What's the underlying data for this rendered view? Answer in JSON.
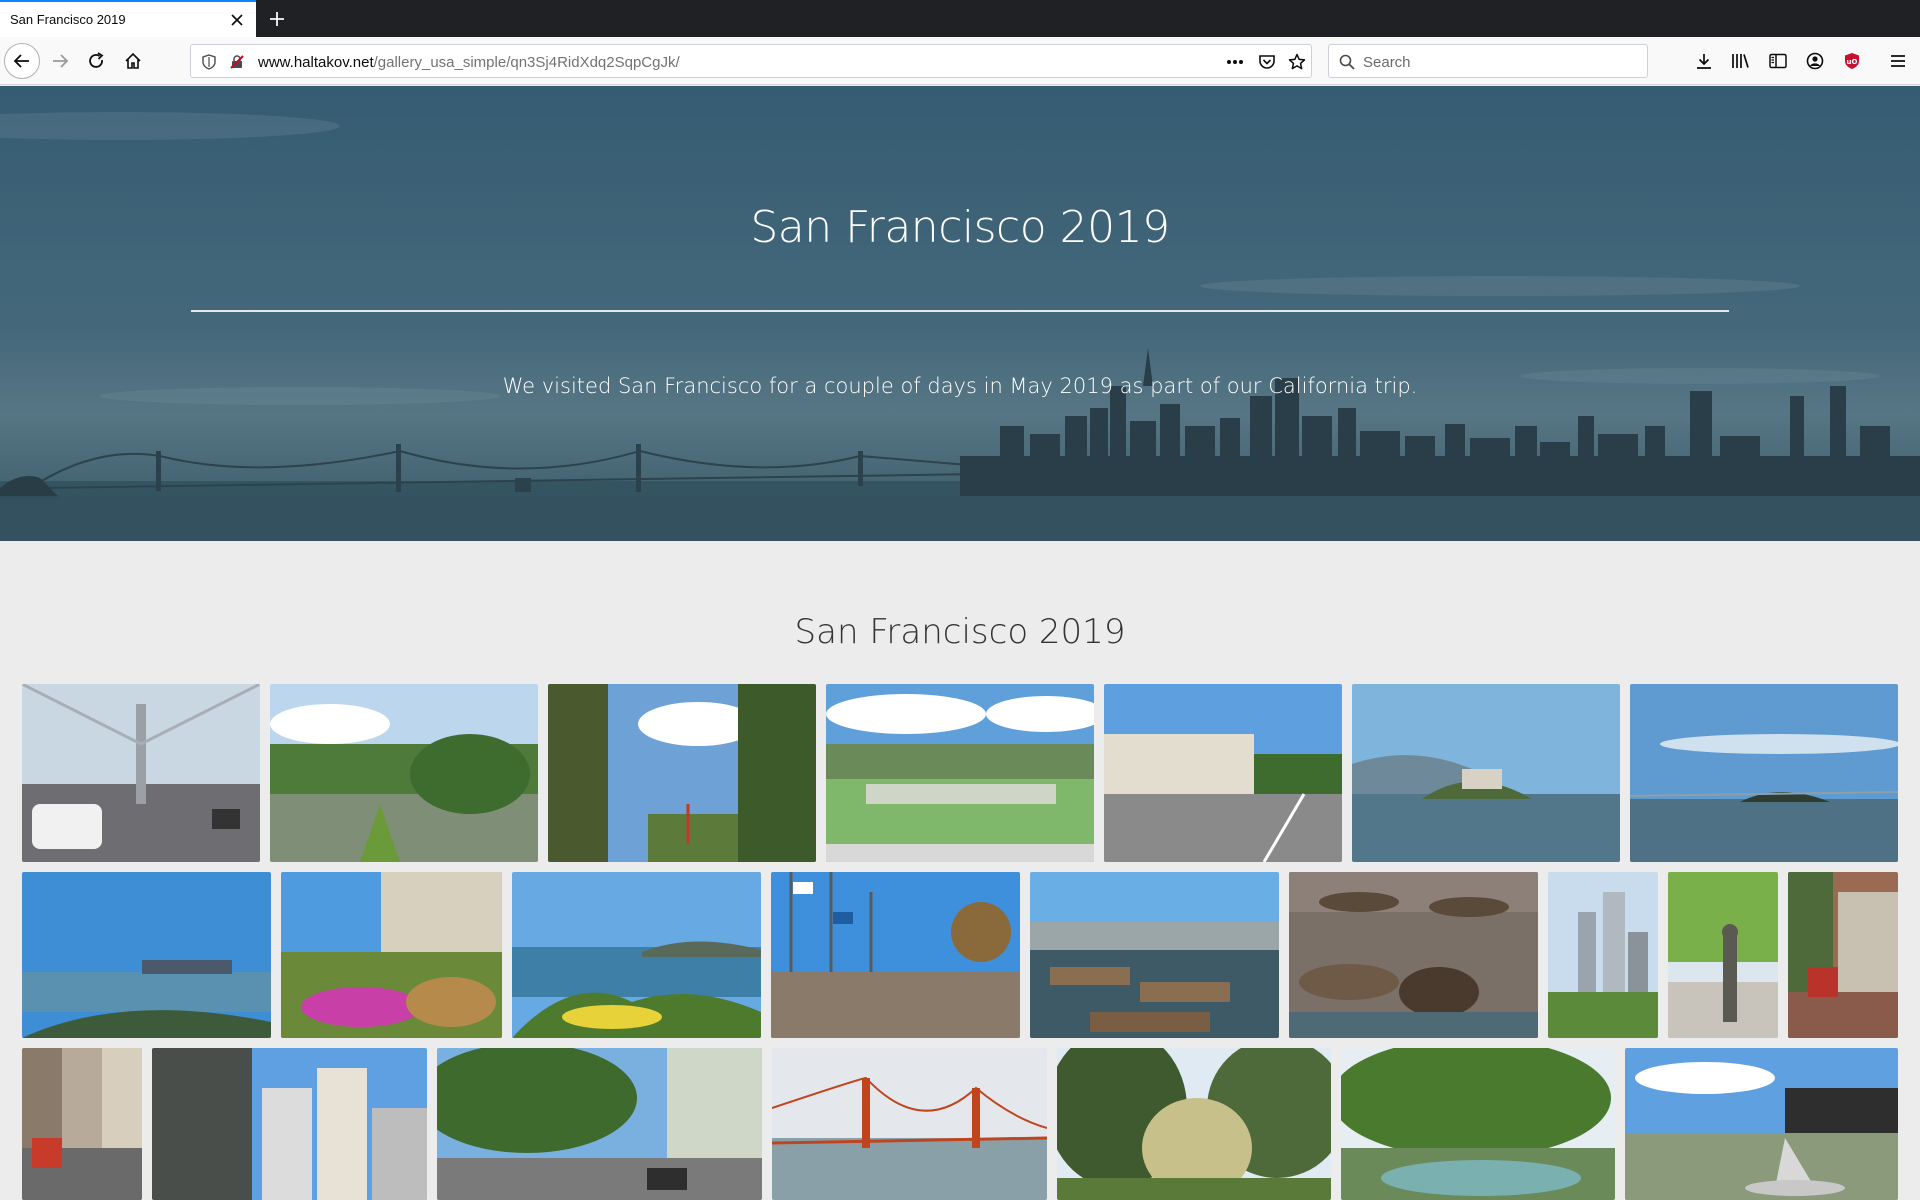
{
  "browser": {
    "tab_title": "San Francisco 2019",
    "url_host": "www.haltakov.net",
    "url_path": "/gallery_usa_simple/qn3Sj4RidXdq2SqpCgJk/",
    "search_placeholder": "Search"
  },
  "hero": {
    "title": "San Francisco 2019",
    "subtitle": "We visited San Francisco for a couple of days in May 2019 as part of our California trip."
  },
  "gallery": {
    "title": "San Francisco 2019"
  },
  "colors": {
    "tab_accent": "#0a84ff",
    "tabbar_bg": "#202124",
    "page_bg": "#ececec",
    "hero_tint": "#4b7489",
    "ublock_red": "#c4122f"
  },
  "icons": [
    "close-icon",
    "plus-icon",
    "back-arrow-icon",
    "forward-arrow-icon",
    "reload-icon",
    "home-icon",
    "shield-icon",
    "insecure-lock-icon",
    "more-dots-icon",
    "pocket-icon",
    "star-icon",
    "search-icon",
    "download-icon",
    "library-icon",
    "sidebar-icon",
    "account-icon",
    "ublock-icon",
    "hamburger-menu-icon"
  ]
}
